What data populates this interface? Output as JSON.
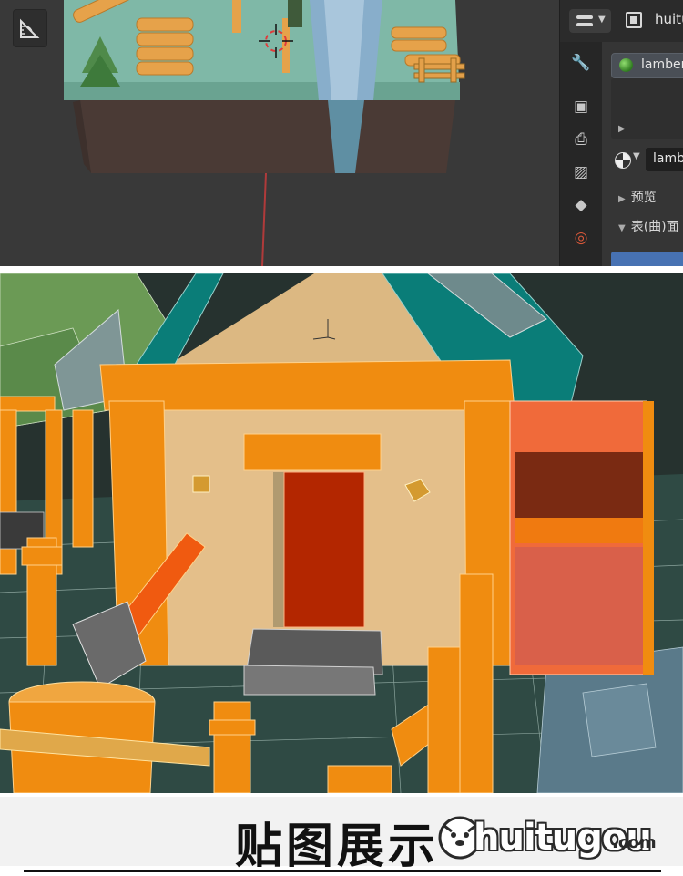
{
  "blender": {
    "header": {
      "object_name": "huitu"
    },
    "material_slot": {
      "name": "lamber"
    },
    "material_field": {
      "name": "lamb"
    },
    "panels": {
      "preview": "预览",
      "surface": "表(曲)面"
    },
    "colors": {
      "accent": "#4772b3",
      "panel": "#303030",
      "viewport": "#393939"
    },
    "tab_icons": [
      "wrench-icon",
      "cube-icon",
      "render-icon",
      "output-icon",
      "image-icon",
      "particles-icon",
      "world-icon"
    ]
  },
  "footer": {
    "title": "贴图展示",
    "watermark": {
      "brand": "huitugou",
      "domain": ".com"
    }
  }
}
